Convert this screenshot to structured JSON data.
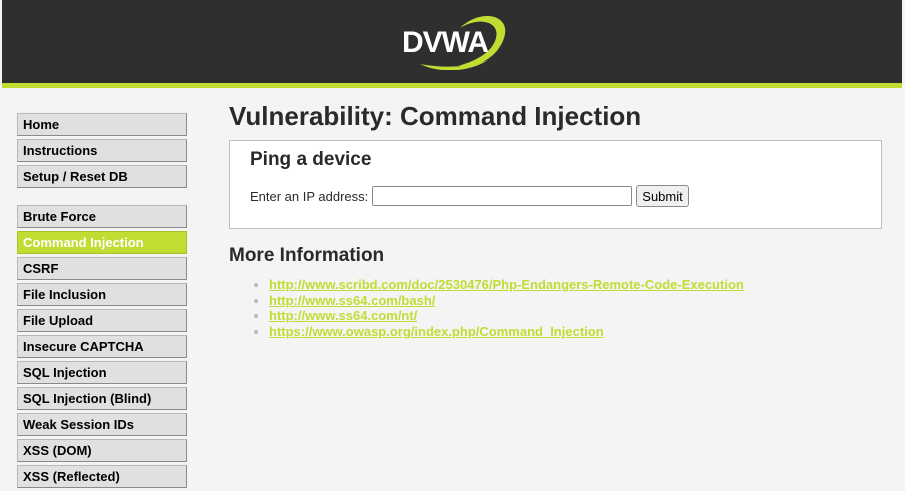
{
  "header": {
    "logo_text": "DVWA",
    "brand_color": "#c0dd34",
    "header_color": "#2f2f2f"
  },
  "menu": {
    "block1": [
      "Home",
      "Instructions",
      "Setup / Reset DB"
    ],
    "block2": [
      "Brute Force",
      "Command Injection",
      "CSRF",
      "File Inclusion",
      "File Upload",
      "Insecure CAPTCHA",
      "SQL Injection",
      "SQL Injection (Blind)",
      "Weak Session IDs",
      "XSS (DOM)",
      "XSS (Reflected)"
    ],
    "selected": "Command Injection"
  },
  "page": {
    "title": "Vulnerability: Command Injection",
    "form": {
      "heading": "Ping a device",
      "ip_label": "Enter an IP address:",
      "ip_value": "",
      "submit_label": "Submit"
    },
    "more_info_title": "More Information",
    "links": [
      "http://www.scribd.com/doc/2530476/Php-Endangers-Remote-Code-Execution",
      "http://www.ss64.com/bash/",
      "http://www.ss64.com/nt/",
      "https://www.owasp.org/index.php/Command_Injection"
    ]
  }
}
